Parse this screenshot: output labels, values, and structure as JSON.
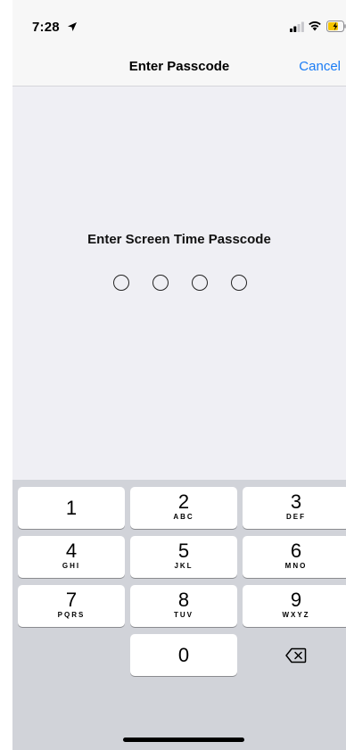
{
  "status_bar": {
    "time": "7:28",
    "location_icon": "location-arrow-icon",
    "signal_icon": "cellular-signal-icon",
    "wifi_icon": "wifi-icon",
    "battery_icon": "battery-charging-icon",
    "battery_color": "#f5c400"
  },
  "nav": {
    "title": "Enter Passcode",
    "cancel_label": "Cancel",
    "accent_color": "#1a7cf5"
  },
  "passcode": {
    "prompt": "Enter Screen Time Passcode",
    "digits_total": 4,
    "digits_entered": 0
  },
  "keypad": {
    "keys": [
      {
        "num": "1",
        "letters": ""
      },
      {
        "num": "2",
        "letters": "ABC"
      },
      {
        "num": "3",
        "letters": "DEF"
      },
      {
        "num": "4",
        "letters": "GHI"
      },
      {
        "num": "5",
        "letters": "JKL"
      },
      {
        "num": "6",
        "letters": "MNO"
      },
      {
        "num": "7",
        "letters": "PQRS"
      },
      {
        "num": "8",
        "letters": "TUV"
      },
      {
        "num": "9",
        "letters": "WXYZ"
      },
      {
        "num": "0",
        "letters": ""
      }
    ],
    "delete_icon": "delete-backspace-icon"
  }
}
